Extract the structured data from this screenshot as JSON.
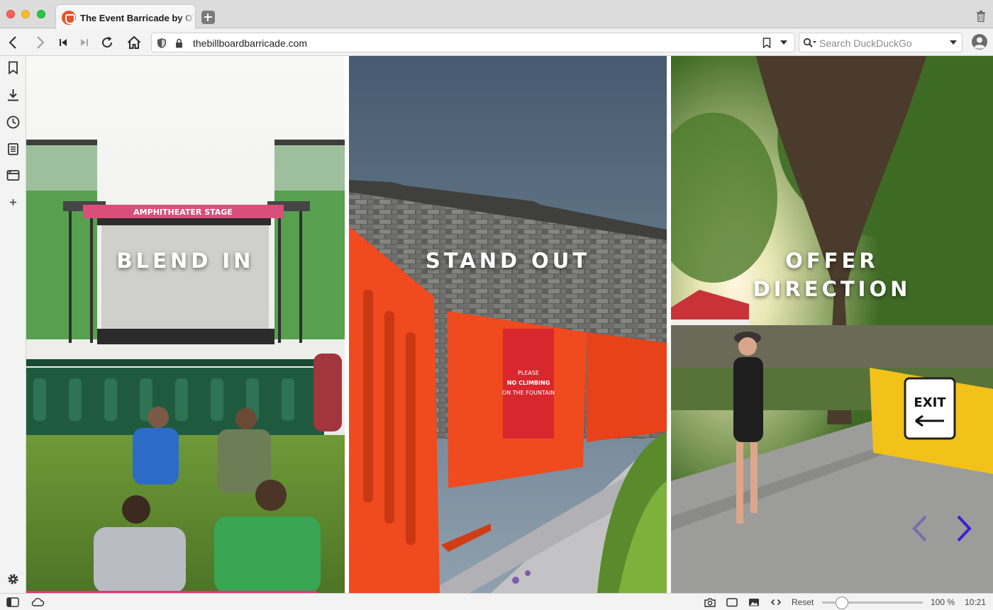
{
  "browser": {
    "tab": {
      "title": "The Event Barricade by OTW Safety"
    },
    "address": {
      "url": "thebillboardbarricade.com"
    },
    "search": {
      "placeholder": "Search DuckDuckGo"
    }
  },
  "hero": {
    "panels": [
      {
        "title": "BLEND IN"
      },
      {
        "title": "STAND OUT"
      },
      {
        "title_line1": "OFFER",
        "title_line2": "DIRECTION"
      }
    ],
    "sign_exit": "EXIT",
    "sign_fountain": [
      "PLEASE",
      "NO CLIMBING",
      "ON THE FOUNTAIN"
    ],
    "stage_banner": "AMPHITHEATER STAGE",
    "accent_color": "#e5336d",
    "barricade_colors": {
      "green": "#1f5a3f",
      "orange": "#f04a1f",
      "yellow": "#f2c21b"
    }
  },
  "statusbar": {
    "reset_label": "Reset",
    "zoom_label": "100 %",
    "zoom_value": 100,
    "clock": "10:21"
  }
}
